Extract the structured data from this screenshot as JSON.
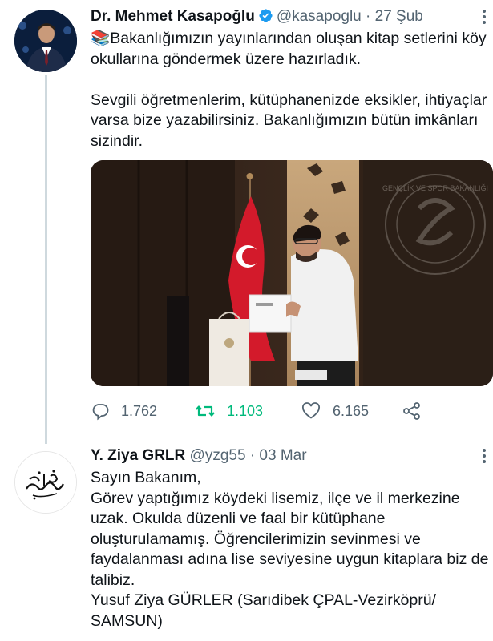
{
  "tweet1": {
    "author_name": "Dr. Mehmet Kasapoğlu",
    "handle": "@kasapoglu",
    "separator": "·",
    "date": "27 Şub",
    "text_line1": "📚Bakanlığımızın yayınlarından oluşan kitap setlerini köy okullarına göndermek üzere hazırladık.",
    "text_line2": "Sevgili öğretmenlerim, kütüphanenizde eksikler, ihtiyaçlar varsa bize yazabilirsiniz. Bakanlığımızın bütün imkânları sizindir.",
    "image_text": "GENÇLİK VE SPOR BAKANLIĞI",
    "stats": {
      "replies": "1.762",
      "retweets": "1.103",
      "likes": "6.165"
    }
  },
  "tweet2": {
    "author_name": "Y. Ziya GRLR",
    "handle": "@yzg55",
    "separator": "·",
    "date": "03 Mar",
    "text": "Sayın Bakanım,\nGörev yaptığımız köydeki lisemiz, ilçe ve il merkezine uzak. Okulda düzenli ve faal bir kütüphane oluşturulamamış. Öğrencilerimizin sevinmesi ve faydalanması adına lise seviyesine uygun kitaplara biz de talibiz.\nYusuf Ziya GÜRLER (Sarıdibek ÇPAL-Vezirköprü/ SAMSUN)"
  },
  "colors": {
    "text": "#0f1419",
    "muted": "#536471",
    "verified": "#1d9bf0",
    "retweet_active": "#00ba7c",
    "thread_line": "#cfd9de"
  },
  "icons": [
    "verified-badge-icon",
    "more-icon",
    "reply-icon",
    "retweet-icon",
    "like-icon",
    "share-icon"
  ]
}
